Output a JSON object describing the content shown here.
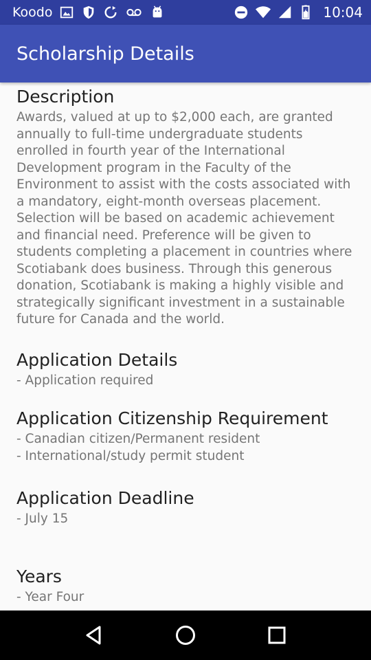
{
  "status_bar": {
    "carrier": "Koodo",
    "time": "10:04",
    "icons_left": [
      "image-icon",
      "shield-icon",
      "sync-icon",
      "voicemail-icon",
      "android-icon"
    ],
    "icons_right": [
      "do-not-disturb-icon",
      "wifi-icon",
      "signal-icon",
      "battery-icon"
    ]
  },
  "app_bar": {
    "title": "Scholarship Details",
    "color": "#3f51b5"
  },
  "sections": {
    "description": {
      "heading": "Description",
      "body": "Awards, valued at up to $2,000 each, are granted annually to full-time undergraduate students enrolled in fourth year of the International Development program in the Faculty of the Environment to assist with the costs associated with a mandatory, eight-month overseas placement. Selection will be based on academic achievement and financial need. Preference will be given to students completing a placement in countries where Scotiabank does business. Through this generous donation, Scotiabank is making a highly visible and strategically significant investment in a sustainable future for Canada and the world."
    },
    "application_details": {
      "heading": "Application Details",
      "items": [
        "- Application required"
      ]
    },
    "citizenship": {
      "heading": "Application Citizenship Requirement",
      "items": [
        "- Canadian citizen/Permanent resident",
        "- International/study permit student"
      ]
    },
    "deadline": {
      "heading": "Application Deadline",
      "items": [
        "- July 15"
      ]
    },
    "years": {
      "heading": "Years",
      "items": [
        "- Year Four"
      ]
    }
  },
  "nav_bar": {
    "buttons": [
      "back-icon",
      "home-icon",
      "recents-icon"
    ]
  }
}
